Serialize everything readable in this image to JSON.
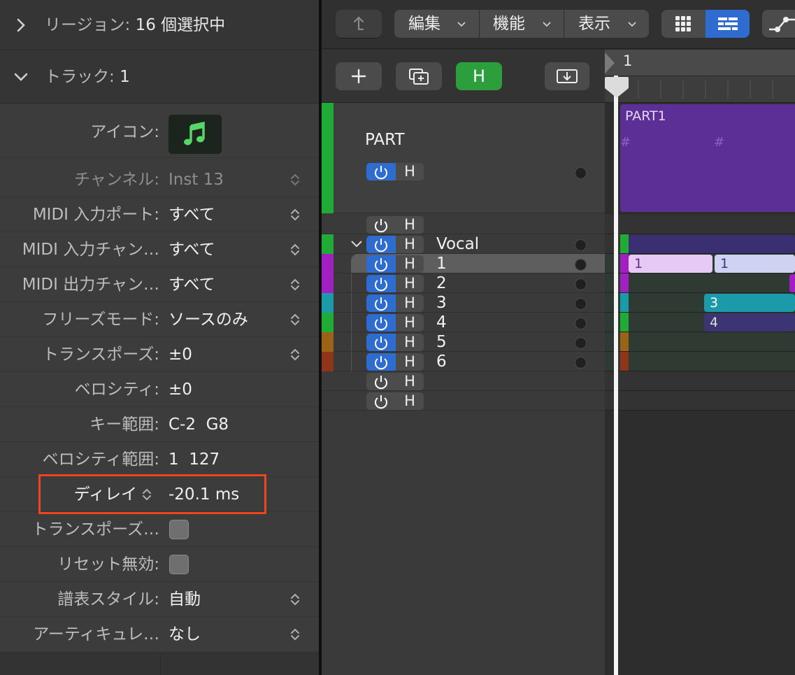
{
  "inspector": {
    "region_header": {
      "label": "リージョン:",
      "value": "16 個選択中"
    },
    "track_header": {
      "label": "トラック:",
      "value": "1"
    },
    "params": [
      {
        "key": "アイコン:",
        "value": ""
      },
      {
        "key": "チャンネル:",
        "value": "Inst 13"
      },
      {
        "key": "MIDI 入力ポート:",
        "value": "すべて"
      },
      {
        "key": "MIDI 入力チャン…",
        "value": "すべて"
      },
      {
        "key": "MIDI 出力チャン…",
        "value": "すべて"
      },
      {
        "key": "フリーズモード:",
        "value": "ソースのみ"
      },
      {
        "key": "トランスポーズ:",
        "value": "±0"
      },
      {
        "key": "ベロシティ:",
        "value": "±0"
      },
      {
        "key": "キー範囲:",
        "value": "C-2  G8"
      },
      {
        "key": "ベロシティ範囲:",
        "value": "1  127"
      },
      {
        "key": "ディレイ",
        "value": "-20.1 ms"
      },
      {
        "key": "トランスポーズ…",
        "value": ""
      },
      {
        "key": "リセット無効:",
        "value": ""
      },
      {
        "key": "譜表スタイル:",
        "value": "自動"
      },
      {
        "key": "アーティキュレ…",
        "value": "なし"
      }
    ]
  },
  "toolbar": {
    "menus": [
      "編集",
      "機能",
      "表示"
    ],
    "hide_label": "H"
  },
  "tracks": {
    "folder": {
      "name": "PART",
      "hide": "H"
    },
    "rows": [
      {
        "name": "",
        "hide": "H",
        "color": "",
        "power": "off"
      },
      {
        "name": "Vocal",
        "hide": "H",
        "color": "#1fab35",
        "power": "on"
      },
      {
        "name": "1",
        "hide": "H",
        "color": "#a21fc2",
        "power": "on"
      },
      {
        "name": "2",
        "hide": "H",
        "color": "#a21fc2",
        "power": "on"
      },
      {
        "name": "3",
        "hide": "H",
        "color": "#1b9aaa",
        "power": "on"
      },
      {
        "name": "4",
        "hide": "H",
        "color": "#1fab35",
        "power": "on"
      },
      {
        "name": "5",
        "hide": "H",
        "color": "#9b6315",
        "power": "on"
      },
      {
        "name": "6",
        "hide": "H",
        "color": "#8f3519",
        "power": "on"
      },
      {
        "name": "",
        "hide": "H",
        "color": "",
        "power": "off"
      },
      {
        "name": "",
        "hide": "H",
        "color": "",
        "power": "off"
      }
    ]
  },
  "timeline": {
    "bar_number": "1",
    "folder_region": {
      "name": "PART1",
      "marker": "#"
    },
    "regions": [
      {
        "label": "1"
      },
      {
        "label": "1"
      },
      {
        "label": "3"
      },
      {
        "label": "4"
      }
    ]
  },
  "colors": {
    "accent_blue": "#2f6cd0",
    "hide_green": "#2c9f3c",
    "folder_purple": "#5b2f96",
    "highlight": "#f0441c"
  }
}
